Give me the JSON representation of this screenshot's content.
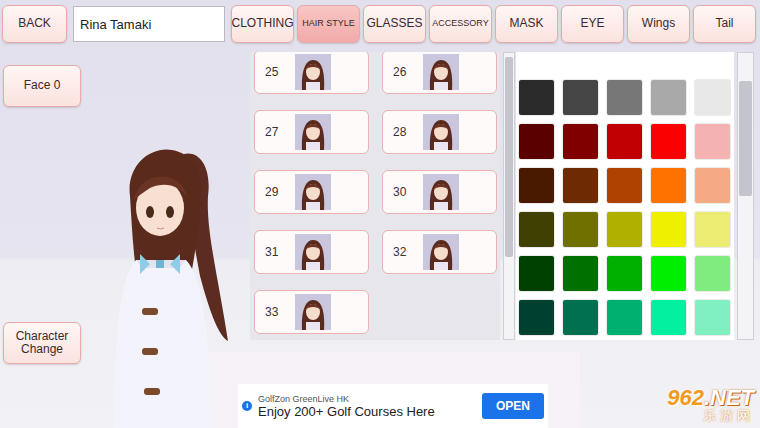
{
  "top_bar": {
    "back_button": "BACK",
    "name_field": "Rina Tamaki"
  },
  "tabs": [
    {
      "label": "CLOTHING",
      "selected": false
    },
    {
      "label": "HAIR STYLE",
      "selected": true
    },
    {
      "label": "GLASSES",
      "selected": false
    },
    {
      "label": "ACCESSORY",
      "selected": false
    },
    {
      "label": "MASK",
      "selected": false
    },
    {
      "label": "EYE",
      "selected": false
    },
    {
      "label": "Wings",
      "selected": false
    },
    {
      "label": "Tail",
      "selected": false
    }
  ],
  "side_buttons": {
    "face": "Face 0",
    "character_change": "Character Change"
  },
  "hair_styles": [
    {
      "number": "25",
      "selected": false
    },
    {
      "number": "26",
      "selected": false
    },
    {
      "number": "27",
      "selected": false
    },
    {
      "number": "28",
      "selected": false
    },
    {
      "number": "29",
      "selected": false
    },
    {
      "number": "30",
      "selected": false
    },
    {
      "number": "31",
      "selected": false
    },
    {
      "number": "32",
      "selected": false
    },
    {
      "number": "33",
      "selected": false
    }
  ],
  "palette": [
    {
      "color": "#2b2b2b"
    },
    {
      "color": "#454545"
    },
    {
      "color": "#777777"
    },
    {
      "color": "#a9a9a9"
    },
    {
      "color": "#e8e8e8"
    },
    {
      "color": "#5a0000"
    },
    {
      "color": "#800000"
    },
    {
      "color": "#c00000"
    },
    {
      "color": "#fa0000"
    },
    {
      "color": "#f4b2b2"
    },
    {
      "color": "#4a1a00"
    },
    {
      "color": "#6e2a00"
    },
    {
      "color": "#b04200"
    },
    {
      "color": "#ff7200"
    },
    {
      "color": "#f4aa82"
    },
    {
      "color": "#404000"
    },
    {
      "color": "#6f7000"
    },
    {
      "color": "#b0b000"
    },
    {
      "color": "#eef000"
    },
    {
      "color": "#ecec72"
    },
    {
      "color": "#004000"
    },
    {
      "color": "#007000"
    },
    {
      "color": "#00b000"
    },
    {
      "color": "#00ee00"
    },
    {
      "color": "#80ec80"
    },
    {
      "color": "#004030"
    },
    {
      "color": "#007050"
    },
    {
      "color": "#00b070"
    },
    {
      "color": "#00f0a0"
    },
    {
      "color": "#80f0c0"
    }
  ],
  "ad": {
    "info": "i",
    "advertiser": "GolfZon GreenLive HK",
    "headline": "Enjoy 200+ Golf Courses Here",
    "button": "OPEN"
  },
  "watermark": {
    "number": "962",
    "suffix": ".NET",
    "name": "乐游网"
  }
}
